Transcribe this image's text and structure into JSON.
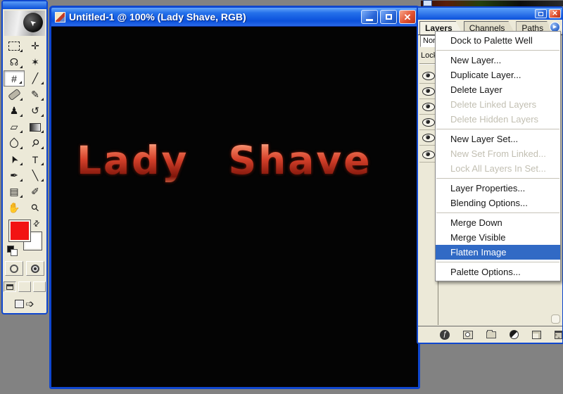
{
  "colors": {
    "workspace_grey": "#828282",
    "xp_titlebar_blue": "#0b51dc",
    "window_border_blue": "#0f47cf",
    "menu_selection_blue": "#316ac5",
    "palette_beige": "#ece9d8",
    "foreground_swatch": "#f21313",
    "background_swatch": "#ffffff",
    "canvas_black": "#040404",
    "canvas_text_red": "#d4402a"
  },
  "document_window": {
    "title": "Untitled-1 @  100% (Lady Shave, RGB)",
    "controls": {
      "close_glyph": "✕"
    },
    "canvas": {
      "text": "Lady Shave"
    }
  },
  "toolbar": {
    "logo_arrow_glyph": "➤",
    "tools": [
      {
        "name": "rectangular-marquee-tool",
        "glyph": ""
      },
      {
        "name": "move-tool",
        "glyph": "✛"
      },
      {
        "name": "lasso-tool",
        "glyph": "☊"
      },
      {
        "name": "magic-wand-tool",
        "glyph": "✶"
      },
      {
        "name": "crop-tool",
        "glyph": "#",
        "state": "active"
      },
      {
        "name": "slice-tool",
        "glyph": "╱"
      },
      {
        "name": "healing-brush-tool",
        "glyph": ""
      },
      {
        "name": "brush-tool",
        "glyph": "✎"
      },
      {
        "name": "clone-stamp-tool",
        "glyph": "♟"
      },
      {
        "name": "history-brush-tool",
        "glyph": "↺"
      },
      {
        "name": "eraser-tool",
        "glyph": "▱"
      },
      {
        "name": "gradient-tool",
        "glyph": ""
      },
      {
        "name": "blur-tool",
        "glyph": ""
      },
      {
        "name": "dodge-tool",
        "glyph": "⚲"
      },
      {
        "name": "path-selection-tool",
        "glyph": "➤"
      },
      {
        "name": "type-tool",
        "glyph": "T"
      },
      {
        "name": "pen-tool",
        "glyph": "✒"
      },
      {
        "name": "line-tool",
        "glyph": "╲"
      },
      {
        "name": "notes-tool",
        "glyph": "▤"
      },
      {
        "name": "eyedropper-tool",
        "glyph": "✐"
      },
      {
        "name": "hand-tool",
        "glyph": "✋"
      },
      {
        "name": "zoom-tool",
        "glyph": "⚲"
      }
    ],
    "swap_arrows_glyph": "⇄",
    "jump_arrow_glyph": "➩"
  },
  "palette": {
    "tabs": [
      {
        "label": "Layers",
        "active": true
      },
      {
        "label": "Channels",
        "active": false
      },
      {
        "label": "Paths",
        "active": false
      }
    ],
    "menu_button_glyph": "▶",
    "controls": {
      "close_glyph": "✕"
    },
    "blend_mode_text": "Nor",
    "lock_text": "Lock",
    "visible_layer_eyes": 6,
    "bottom_buttons": [
      {
        "name": "layer-style-button",
        "glyph": "ƒ"
      },
      {
        "name": "add-mask-button"
      },
      {
        "name": "new-layer-set-button"
      },
      {
        "name": "adjustment-layer-button"
      },
      {
        "name": "new-layer-button"
      },
      {
        "name": "delete-layer-button"
      }
    ]
  },
  "menu": {
    "items": [
      {
        "label": "Dock to Palette Well",
        "state": "enabled"
      },
      {
        "label": "New Layer...",
        "state": "enabled"
      },
      {
        "label": "Duplicate Layer...",
        "state": "enabled"
      },
      {
        "label": "Delete Layer",
        "state": "enabled"
      },
      {
        "label": "Delete Linked Layers",
        "state": "disabled"
      },
      {
        "label": "Delete Hidden Layers",
        "state": "disabled"
      },
      {
        "label": "New Layer Set...",
        "state": "enabled"
      },
      {
        "label": "New Set From Linked...",
        "state": "disabled"
      },
      {
        "label": "Lock All Layers In Set...",
        "state": "disabled"
      },
      {
        "label": "Layer Properties...",
        "state": "enabled"
      },
      {
        "label": "Blending Options...",
        "state": "enabled"
      },
      {
        "label": "Merge Down",
        "state": "enabled"
      },
      {
        "label": "Merge Visible",
        "state": "enabled"
      },
      {
        "label": "Flatten Image",
        "state": "selected"
      },
      {
        "label": "Palette Options...",
        "state": "enabled"
      }
    ]
  }
}
